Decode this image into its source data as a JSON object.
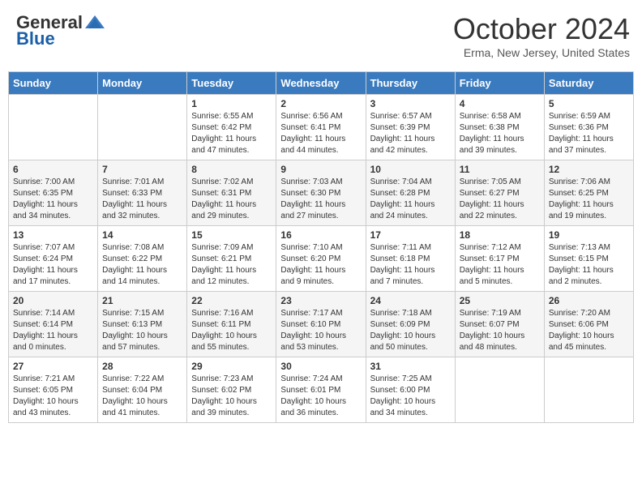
{
  "header": {
    "logo_general": "General",
    "logo_blue": "Blue",
    "month": "October 2024",
    "location": "Erma, New Jersey, United States"
  },
  "weekdays": [
    "Sunday",
    "Monday",
    "Tuesday",
    "Wednesday",
    "Thursday",
    "Friday",
    "Saturday"
  ],
  "weeks": [
    [
      {
        "day": "",
        "info": ""
      },
      {
        "day": "",
        "info": ""
      },
      {
        "day": "1",
        "info": "Sunrise: 6:55 AM\nSunset: 6:42 PM\nDaylight: 11 hours and 47 minutes."
      },
      {
        "day": "2",
        "info": "Sunrise: 6:56 AM\nSunset: 6:41 PM\nDaylight: 11 hours and 44 minutes."
      },
      {
        "day": "3",
        "info": "Sunrise: 6:57 AM\nSunset: 6:39 PM\nDaylight: 11 hours and 42 minutes."
      },
      {
        "day": "4",
        "info": "Sunrise: 6:58 AM\nSunset: 6:38 PM\nDaylight: 11 hours and 39 minutes."
      },
      {
        "day": "5",
        "info": "Sunrise: 6:59 AM\nSunset: 6:36 PM\nDaylight: 11 hours and 37 minutes."
      }
    ],
    [
      {
        "day": "6",
        "info": "Sunrise: 7:00 AM\nSunset: 6:35 PM\nDaylight: 11 hours and 34 minutes."
      },
      {
        "day": "7",
        "info": "Sunrise: 7:01 AM\nSunset: 6:33 PM\nDaylight: 11 hours and 32 minutes."
      },
      {
        "day": "8",
        "info": "Sunrise: 7:02 AM\nSunset: 6:31 PM\nDaylight: 11 hours and 29 minutes."
      },
      {
        "day": "9",
        "info": "Sunrise: 7:03 AM\nSunset: 6:30 PM\nDaylight: 11 hours and 27 minutes."
      },
      {
        "day": "10",
        "info": "Sunrise: 7:04 AM\nSunset: 6:28 PM\nDaylight: 11 hours and 24 minutes."
      },
      {
        "day": "11",
        "info": "Sunrise: 7:05 AM\nSunset: 6:27 PM\nDaylight: 11 hours and 22 minutes."
      },
      {
        "day": "12",
        "info": "Sunrise: 7:06 AM\nSunset: 6:25 PM\nDaylight: 11 hours and 19 minutes."
      }
    ],
    [
      {
        "day": "13",
        "info": "Sunrise: 7:07 AM\nSunset: 6:24 PM\nDaylight: 11 hours and 17 minutes."
      },
      {
        "day": "14",
        "info": "Sunrise: 7:08 AM\nSunset: 6:22 PM\nDaylight: 11 hours and 14 minutes."
      },
      {
        "day": "15",
        "info": "Sunrise: 7:09 AM\nSunset: 6:21 PM\nDaylight: 11 hours and 12 minutes."
      },
      {
        "day": "16",
        "info": "Sunrise: 7:10 AM\nSunset: 6:20 PM\nDaylight: 11 hours and 9 minutes."
      },
      {
        "day": "17",
        "info": "Sunrise: 7:11 AM\nSunset: 6:18 PM\nDaylight: 11 hours and 7 minutes."
      },
      {
        "day": "18",
        "info": "Sunrise: 7:12 AM\nSunset: 6:17 PM\nDaylight: 11 hours and 5 minutes."
      },
      {
        "day": "19",
        "info": "Sunrise: 7:13 AM\nSunset: 6:15 PM\nDaylight: 11 hours and 2 minutes."
      }
    ],
    [
      {
        "day": "20",
        "info": "Sunrise: 7:14 AM\nSunset: 6:14 PM\nDaylight: 11 hours and 0 minutes."
      },
      {
        "day": "21",
        "info": "Sunrise: 7:15 AM\nSunset: 6:13 PM\nDaylight: 10 hours and 57 minutes."
      },
      {
        "day": "22",
        "info": "Sunrise: 7:16 AM\nSunset: 6:11 PM\nDaylight: 10 hours and 55 minutes."
      },
      {
        "day": "23",
        "info": "Sunrise: 7:17 AM\nSunset: 6:10 PM\nDaylight: 10 hours and 53 minutes."
      },
      {
        "day": "24",
        "info": "Sunrise: 7:18 AM\nSunset: 6:09 PM\nDaylight: 10 hours and 50 minutes."
      },
      {
        "day": "25",
        "info": "Sunrise: 7:19 AM\nSunset: 6:07 PM\nDaylight: 10 hours and 48 minutes."
      },
      {
        "day": "26",
        "info": "Sunrise: 7:20 AM\nSunset: 6:06 PM\nDaylight: 10 hours and 45 minutes."
      }
    ],
    [
      {
        "day": "27",
        "info": "Sunrise: 7:21 AM\nSunset: 6:05 PM\nDaylight: 10 hours and 43 minutes."
      },
      {
        "day": "28",
        "info": "Sunrise: 7:22 AM\nSunset: 6:04 PM\nDaylight: 10 hours and 41 minutes."
      },
      {
        "day": "29",
        "info": "Sunrise: 7:23 AM\nSunset: 6:02 PM\nDaylight: 10 hours and 39 minutes."
      },
      {
        "day": "30",
        "info": "Sunrise: 7:24 AM\nSunset: 6:01 PM\nDaylight: 10 hours and 36 minutes."
      },
      {
        "day": "31",
        "info": "Sunrise: 7:25 AM\nSunset: 6:00 PM\nDaylight: 10 hours and 34 minutes."
      },
      {
        "day": "",
        "info": ""
      },
      {
        "day": "",
        "info": ""
      }
    ]
  ]
}
